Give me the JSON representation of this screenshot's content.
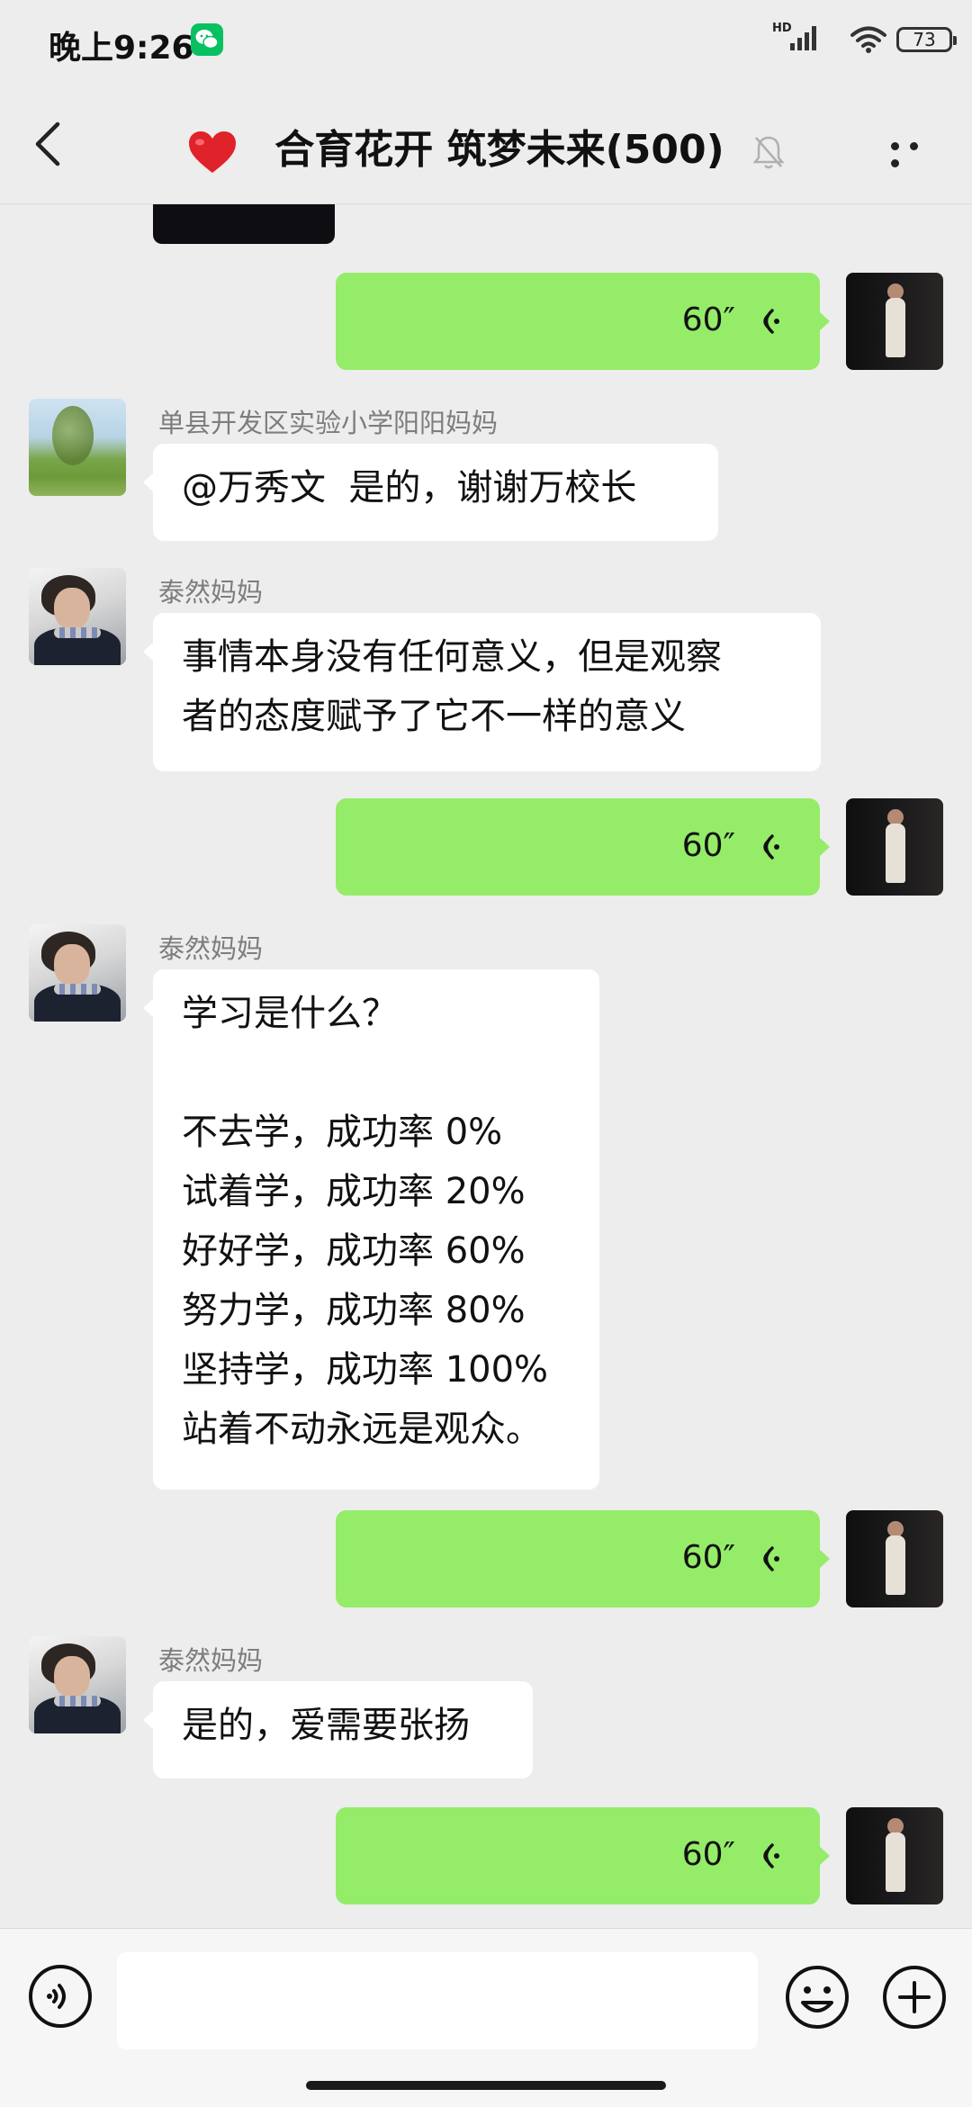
{
  "status_bar": {
    "time": "晚上9:26",
    "network": "HD",
    "battery": "73"
  },
  "header": {
    "title": "合育花开 筑梦未来(500)"
  },
  "messages": [
    {
      "type": "voice",
      "duration": "60″"
    },
    {
      "type": "text",
      "sender": "单县开发区实验小学阳阳妈妈",
      "text": "@万秀文  是的，谢谢万校长"
    },
    {
      "type": "text",
      "sender": "泰然妈妈",
      "text": "事情本身没有任何意义，但是观察\n者的态度赋予了它不一样的意义"
    },
    {
      "type": "voice",
      "duration": "60″"
    },
    {
      "type": "text",
      "sender": "泰然妈妈",
      "text": "学习是什么？\n\n不去学，成功率 0%\n试着学，成功率 20%\n好好学，成功率 60%\n努力学，成功率 80%\n坚持学，成功率 100%\n站着不动永远是观众。"
    },
    {
      "type": "voice",
      "duration": "60″"
    },
    {
      "type": "text",
      "sender": "泰然妈妈",
      "text": "是的，爱需要张扬"
    },
    {
      "type": "voice",
      "duration": "60″"
    }
  ],
  "input": {
    "value": "",
    "placeholder": ""
  },
  "colors": {
    "voice_bubble": "#95ec69",
    "background": "#ededed",
    "wechat_green": "#07c160"
  },
  "icons": [
    "back-arrow-icon",
    "heart-icon",
    "mute-bell-icon",
    "more-icon",
    "voice-wave-icon",
    "voice-input-icon",
    "emoji-icon",
    "plus-icon"
  ]
}
